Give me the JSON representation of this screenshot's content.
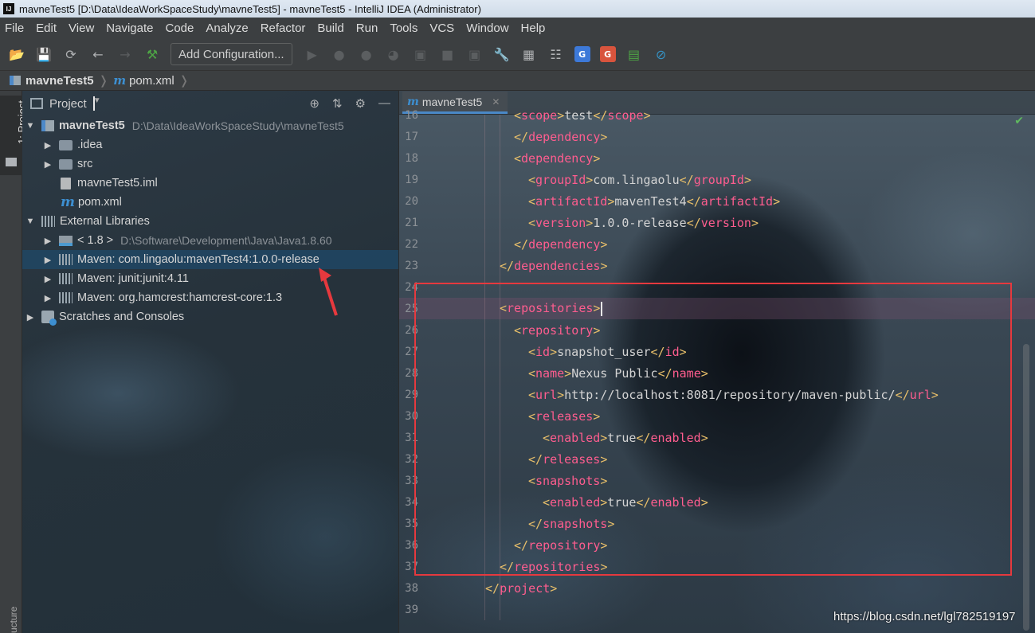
{
  "window": {
    "title": "mavneTest5 [D:\\Data\\IdeaWorkSpaceStudy\\mavneTest5] - mavneTest5 - IntelliJ IDEA (Administrator)",
    "app_icon": "IJ"
  },
  "menu": [
    "File",
    "Edit",
    "View",
    "Navigate",
    "Code",
    "Analyze",
    "Refactor",
    "Build",
    "Run",
    "Tools",
    "VCS",
    "Window",
    "Help"
  ],
  "toolbar": {
    "add_configuration": "Add Configuration..."
  },
  "breadcrumb": {
    "project": "mavneTest5",
    "file": "pom.xml"
  },
  "side_strip": {
    "project_tab": "1: Project",
    "structure_tab": "ucture"
  },
  "project_panel": {
    "title": "Project",
    "tree": [
      {
        "label": "mavneTest5",
        "path": "D:\\Data\\IdeaWorkSpaceStudy\\mavneTest5"
      },
      {
        "label": ".idea"
      },
      {
        "label": "src"
      },
      {
        "label": "mavneTest5.iml"
      },
      {
        "label": "pom.xml"
      },
      {
        "label": "External Libraries"
      },
      {
        "label": "< 1.8 >",
        "path": "D:\\Software\\Development\\Java\\Java1.8.60"
      },
      {
        "label": "Maven: com.lingaolu:mavenTest4:1.0.0-release"
      },
      {
        "label": "Maven: junit:junit:4.11"
      },
      {
        "label": "Maven: org.hamcrest:hamcrest-core:1.3"
      },
      {
        "label": "Scratches and Consoles"
      }
    ]
  },
  "editor": {
    "tab": "mavneTest5",
    "lines": [
      {
        "n": "16",
        "indent": 3,
        "tag": "scope",
        "text": "test"
      },
      {
        "n": "17",
        "indent": 3,
        "close": "dependency"
      },
      {
        "n": "18",
        "indent": 3,
        "open": "dependency"
      },
      {
        "n": "19",
        "indent": 4,
        "tag": "groupId",
        "text": "com.lingaolu"
      },
      {
        "n": "20",
        "indent": 4,
        "tag": "artifactId",
        "text": "mavenTest4"
      },
      {
        "n": "21",
        "indent": 4,
        "tag": "version",
        "text": "1.0.0-release"
      },
      {
        "n": "22",
        "indent": 3,
        "close": "dependency"
      },
      {
        "n": "23",
        "indent": 2,
        "close": "dependencies"
      },
      {
        "n": "24",
        "indent": 0
      },
      {
        "n": "25",
        "indent": 2,
        "open": "repositories"
      },
      {
        "n": "26",
        "indent": 3,
        "open": "repository"
      },
      {
        "n": "27",
        "indent": 4,
        "tag": "id",
        "text": "snapshot_user"
      },
      {
        "n": "28",
        "indent": 4,
        "tag": "name",
        "text": "Nexus Public"
      },
      {
        "n": "29",
        "indent": 4,
        "tag": "url",
        "text": "http://localhost:8081/repository/maven-public/"
      },
      {
        "n": "30",
        "indent": 4,
        "open": "releases"
      },
      {
        "n": "31",
        "indent": 5,
        "tag": "enabled",
        "text": "true"
      },
      {
        "n": "32",
        "indent": 4,
        "close": "releases"
      },
      {
        "n": "33",
        "indent": 4,
        "open": "snapshots"
      },
      {
        "n": "34",
        "indent": 5,
        "tag": "enabled",
        "text": "true"
      },
      {
        "n": "35",
        "indent": 4,
        "close": "snapshots"
      },
      {
        "n": "36",
        "indent": 3,
        "close": "repository"
      },
      {
        "n": "37",
        "indent": 2,
        "close": "repositories"
      },
      {
        "n": "38",
        "indent": 1,
        "close": "project"
      },
      {
        "n": "39",
        "indent": 0
      }
    ]
  },
  "watermark": "https://blog.csdn.net/lgl782519197",
  "colors": {
    "annotation": "#e6393e",
    "tag_name": "#ff5d8f",
    "bracket": "#e8bf6a"
  }
}
